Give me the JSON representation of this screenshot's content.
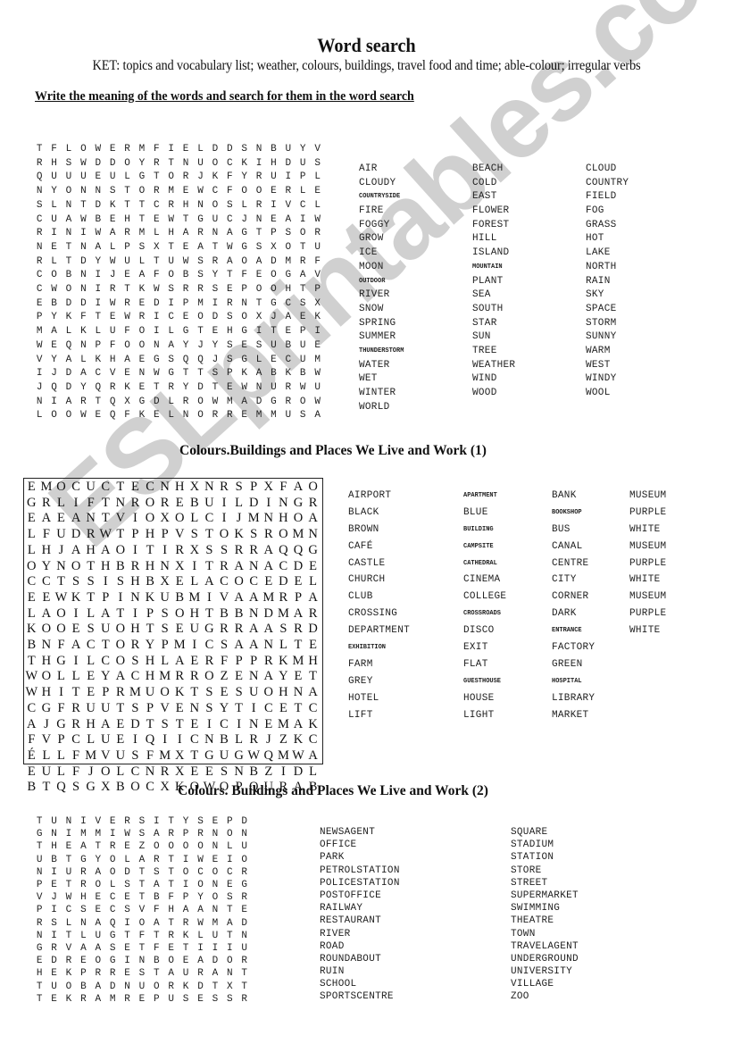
{
  "header": {
    "title": "Word search",
    "subtitle": "KET: topics and vocabulary list; weather, colours, buildings, travel food and time; able-colour; irregular verbs",
    "instruction": "Write the meaning of the words and search for them in the word search"
  },
  "watermark": "ESLprintables.com",
  "section1": {
    "grid": [
      "TFLOWERMFIELDDSNBUYV",
      "RHSWDDOYRTNUOCKIHDUS",
      "QUUUEULGTORJKFYRUIPL",
      "NYONNSTORMEWCFOOERLE",
      "SLNTDKTTCRHNOSLRIVCL",
      "CUAWBEHTEWTGUCJNEAIW",
      "RINIWARMLHARNAGTPSOR",
      "NETNALPSXTEATWGSXOTU",
      "RLTDYWULTUWSRAOADMRF",
      "COBNIJEAFOBSYTFEOGAV",
      "CWONIRTKWSRRSEPOOHTP",
      "EBDDIWREDIPMIRNTGCSX",
      "PYKFTEWRICEODSOXJAEK",
      "MALKLUFOILGTEHGITEPI",
      "WEQNPFOONAYJYSESUBUE",
      "VYALKHAEGSQQJSGLECUM",
      "IJDACVENWGTTSPKABKBW",
      "JQDYQRKETRYDTEWNURWU",
      "NIARTQXGDLROWMADGROW",
      "LOOWEQFKELNORREMMUSA"
    ],
    "word_columns": [
      [
        "AIR",
        "CLOUDY",
        "COUNTRYSIDE",
        "FIRE",
        "FOGGY",
        "GROW",
        "ICE",
        "MOON",
        "OUTDOOR",
        "RIVER",
        "SNOW",
        "SPRING",
        "SUMMER",
        "THUNDERSTORM",
        "WATER",
        "WET",
        "WINTER",
        "WORLD"
      ],
      [
        "BEACH",
        "COLD",
        "EAST",
        "FLOWER",
        "FOREST",
        "HILL",
        "ISLAND",
        "MOUNTAIN",
        "PLANT",
        "SEA",
        "SOUTH",
        "STAR",
        "SUN",
        "TREE",
        "WEATHER",
        "WIND",
        "WOOD"
      ],
      [
        "CLOUD",
        "COUNTRY",
        "FIELD",
        "FOG",
        "GRASS",
        "HOT",
        "LAKE",
        "NORTH",
        "RAIN",
        "SKY",
        "SPACE",
        "STORM",
        "SUNNY",
        "WARM",
        "WEST",
        "WINDY",
        "WOOL"
      ]
    ],
    "small_words": [
      "COUNTRYSIDE",
      "OUTDOOR",
      "THUNDERSTORM",
      "MOUNTAIN"
    ]
  },
  "section2": {
    "heading": "Colours.Buildings and Places We Live and Work (1)",
    "grid": [
      "EMOCUCTECNHXNRSPXFAO",
      "GRLIFTNROREBUILDINGR",
      "EAEANTVIOXOLCIJMNHOA",
      "LFUDRWTPHPVSTOKSROMN",
      "LHJAHAOITIRXSSRRAQQG",
      "OYNOTHBRHNXITRANACDE",
      "CCTSSISHBXELACOCEDEL",
      "EEWKTPINKUBMIVAAMRPA",
      "LAOILATIPSOHTBBNDMAR",
      "KOOESUOHTSEUGRRAASRD",
      "BNFACTORYPMICSAANLTE",
      "THGILCOSHLAERFPPRKMH",
      "WOLLEYACHMRROZENAYET",
      "WHITEPRMUOKTSESUOHNA",
      "CGFRUUTSPVENSYTICETC",
      "AJGRHAEDTSTEICINEMAK",
      "FVPCLUEIQIICNBLRJZKC",
      "ÉLLFMVUSFMXTGUGWQMWA",
      "EULFJOLCNRXEESNBZIDL",
      "BTQSGXBOCXKOWOPQURAB"
    ],
    "word_columns": [
      [
        "AIRPORT",
        "BLACK",
        "BROWN",
        "CAFÉ",
        "CASTLE",
        "CHURCH",
        "CLUB",
        "CROSSING",
        "DEPARTMENT",
        "EXHIBITION",
        "FARM",
        "GREY",
        "HOTEL",
        "LIFT"
      ],
      [
        "APARTMENT",
        "BLUE",
        "BUILDING",
        "CAMPSITE",
        "CATHEDRAL",
        "CINEMA",
        "COLLEGE",
        "CROSSROADS",
        "DISCO",
        "EXIT",
        "FLAT",
        "GUESTHOUSE",
        "HOUSE",
        "LIGHT"
      ],
      [
        "BANK",
        "BOOKSHOP",
        "BUS",
        "CANAL",
        "CENTRE",
        "CITY",
        "CORNER",
        "DARK",
        "ENTRANCE",
        "FACTORY",
        "GREEN",
        "HOSPITAL",
        "LIBRARY",
        "MARKET"
      ],
      [
        "MUSEUM",
        "PURPLE",
        "WHITE",
        "MUSEUM",
        "PURPLE",
        "WHITE",
        "MUSEUM",
        "PURPLE",
        "WHITE"
      ]
    ],
    "small_words": [
      "APARTMENT",
      "BUILDING",
      "CAMPSITE",
      "CATHEDRAL",
      "BOOKSHOP",
      "EXHIBITION",
      "ENTRANCE",
      "HOSPITAL",
      "CROSSROADS",
      "GUESTHOUSE"
    ]
  },
  "section3": {
    "heading": "Colours. Buildings and Places We Live and Work (2)",
    "grid": [
      "TUNIVERSITYSEPD",
      "GNIMMIWSARPRNON",
      "THEATREZOOOONLU",
      "UBTGYOLARTIWEIO",
      "NIURAODTSTOCOCR",
      "PETROLSTATIONEG",
      "VJWHECETBFPYOSR",
      "PICSECSVFHAANTE",
      "RSLNAQIOATRWMAD",
      "NITLUGTFTRKLUTN",
      "GRVAASETFETIIIU",
      "EDREOGINBOEADOR",
      "HEKPRRESTAURANT",
      "TUOBADNUORKDTXT",
      "TEKRAMREPUSESSR"
    ],
    "word_columns": [
      [
        "NEWSAGENT",
        "OFFICE",
        "PARK",
        "PETROLSTATION",
        "POLICESTATION",
        "POSTOFFICE",
        "RAILWAY",
        "RESTAURANT",
        "RIVER",
        "ROAD",
        "ROUNDABOUT",
        "RUIN",
        "SCHOOL",
        "SPORTSCENTRE"
      ],
      [
        "SQUARE",
        "STADIUM",
        "STATION",
        "STORE",
        "STREET",
        "SUPERMARKET",
        "SWIMMING",
        "THEATRE",
        "TOWN",
        "TRAVELAGENT",
        "UNDERGROUND",
        "UNIVERSITY",
        "VILLAGE",
        "ZOO"
      ]
    ]
  }
}
